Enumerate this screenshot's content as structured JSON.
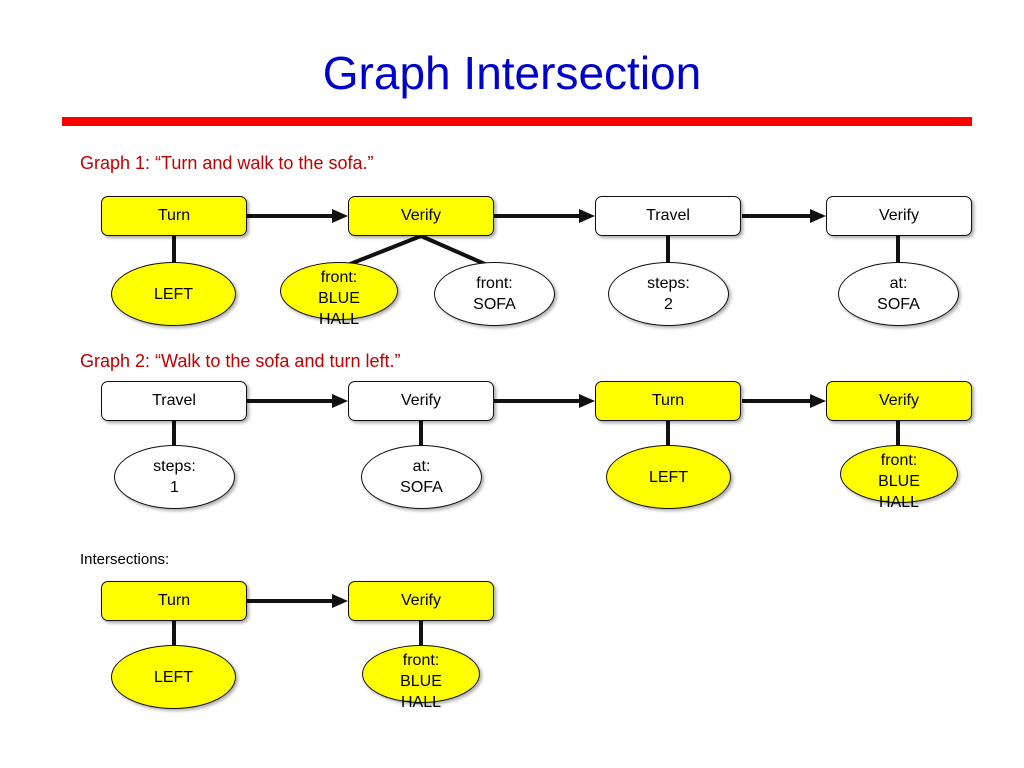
{
  "slide": {
    "title": "Graph Intersection",
    "title_color": "#0000CC",
    "rule_color": "#FF0000",
    "highlight_color": "#FFFF00",
    "label_color": "#C00000"
  },
  "sections": [
    {
      "id": "graph1",
      "label": "Graph 1: “Turn and walk to the sofa.”"
    },
    {
      "id": "graph2",
      "label": "Graph 2: “Walk to the sofa and turn left.”"
    },
    {
      "id": "intersections",
      "label": "Intersections:"
    }
  ],
  "graph1": {
    "boxes": [
      {
        "label": "Turn",
        "highlighted": true
      },
      {
        "label": "Verify",
        "highlighted": true
      },
      {
        "label": "Travel",
        "highlighted": false
      },
      {
        "label": "Verify",
        "highlighted": false
      }
    ],
    "ellipses": [
      {
        "lines": [
          "LEFT"
        ],
        "highlighted": true
      },
      {
        "lines": [
          "front:",
          "BLUE",
          "HALL"
        ],
        "highlighted": true
      },
      {
        "lines": [
          "front:",
          "SOFA"
        ],
        "highlighted": false
      },
      {
        "lines": [
          "steps:",
          "2"
        ],
        "highlighted": false
      },
      {
        "lines": [
          "at:",
          "SOFA"
        ],
        "highlighted": false
      }
    ]
  },
  "graph2": {
    "boxes": [
      {
        "label": "Travel",
        "highlighted": false
      },
      {
        "label": "Verify",
        "highlighted": false
      },
      {
        "label": "Turn",
        "highlighted": true
      },
      {
        "label": "Verify",
        "highlighted": true
      }
    ],
    "ellipses": [
      {
        "lines": [
          "steps:",
          "1"
        ],
        "highlighted": false
      },
      {
        "lines": [
          "at:",
          "SOFA"
        ],
        "highlighted": false
      },
      {
        "lines": [
          "LEFT"
        ],
        "highlighted": true
      },
      {
        "lines": [
          "front:",
          "BLUE",
          "HALL"
        ],
        "highlighted": true
      }
    ]
  },
  "intersections": {
    "boxes": [
      {
        "label": "Turn",
        "highlighted": true
      },
      {
        "label": "Verify",
        "highlighted": true
      }
    ],
    "ellipses": [
      {
        "lines": [
          "LEFT"
        ],
        "highlighted": true
      },
      {
        "lines": [
          "front:",
          "BLUE",
          "HALL"
        ],
        "highlighted": true
      }
    ]
  }
}
